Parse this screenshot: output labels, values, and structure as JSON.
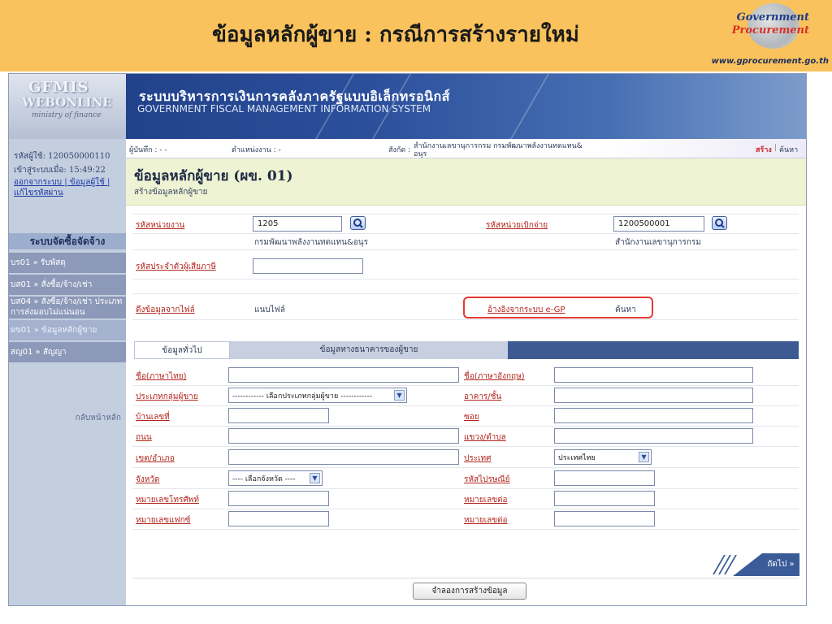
{
  "slide": {
    "title": "ข้อมูลหลักผู้ขาย : กรณีการสร้างรายใหม่",
    "logo_line1": "Government",
    "logo_line2": "Procurement",
    "logo_url": "www.gprocurement.go.th"
  },
  "banner": {
    "gfmis": "GFMIS",
    "webonline": "WEBONLINE",
    "ministry": "ministry of finance",
    "system_thai": "ระบบบริหารการเงินการคลังภาครัฐแบบอิเล็กทรอนิกส์",
    "system_eng": "GOVERNMENT FISCAL MANAGEMENT INFORMATION SYSTEM"
  },
  "sidebar": {
    "user_id": "รหัสผู้ใช้: 120050000110",
    "login_time": "เข้าสู่ระบบเมื่อ: 15:49:22",
    "links_line1": "ออกจากระบบ | ข้อมูลผู้ใช้ |",
    "links_line2": "แก้ไขรหัสผ่าน",
    "menu_header": "ระบบจัดซื้อจัดจ้าง",
    "items": [
      {
        "label": "บร01 » รับพัสดุ"
      },
      {
        "label": "บส01 » สั่งซื้อ/จ้าง/เช่า"
      },
      {
        "label": "บส04 » สั่งซื้อ/จ้าง/เช่า ประเภท"
      },
      {
        "label": "การส่งมอบไม่แน่นอน"
      },
      {
        "label": "ผข01 » ข้อมูลหลักผู้ขาย"
      },
      {
        "label": "สญ01 » สัญญา"
      }
    ],
    "back_label": "กลับหน้าหลัก"
  },
  "infobar": {
    "recorder": "ผู้บันทึก : - -",
    "position": "ตำแหน่งงาน : -",
    "affiliation_label": "สังกัด :",
    "affiliation_line1": "สำนักงานเลขานุการกรม กรมพัฒนาพลังงานทดแทน&",
    "affiliation_line2": "อนุร",
    "create": "สร้าง",
    "search": "ค้นหา"
  },
  "page": {
    "title": "ข้อมูลหลักผู้ขาย (ผข. 01)",
    "subtitle": "สร้างข้อมูลหลักผู้ขาย"
  },
  "header_form": {
    "unit_code_label": "รหัสหน่วยงาน",
    "unit_code_value": "1205",
    "unit_name": "กรมพัฒนาพลังงานทดแทน&อนุร",
    "disburse_code_label": "รหัสหน่วยเบิกจ่าย",
    "disburse_code_value": "1200500001",
    "disburse_name": "สำนักงานเลขานุการกรม",
    "tax_id_label": "รหัสประจำตัวผู้เสียภาษี",
    "tax_id_value": "",
    "file_label": "ดึงข้อมูลจากไฟล์",
    "file_value": "แนบไฟล์",
    "egp_label": "อ้างอิงจากระบบ e-GP",
    "egp_value": "ค้นหา"
  },
  "tabs": [
    {
      "label": "ข้อมูลทั่วไป"
    },
    {
      "label": "ข้อมูลทางธนาคารของผู้ขาย"
    }
  ],
  "general_form": {
    "name_th": "ชื่อ(ภาษาไทย)",
    "name_en": "ชื่อ(ภาษาอังกฤษ)",
    "vendor_group": "ประเภทกลุ่มผู้ขาย",
    "vendor_group_select": "------------ เลือกประเภทกลุ่มผู้ขาย ------------",
    "building": "อาคาร/ชั้น",
    "house_no": "บ้านเลขที่",
    "soi": "ซอย",
    "road": "ถนน",
    "subdistrict": "แขวง/ตำบล",
    "district": "เขต/อำเภอ",
    "country": "ประเทศ",
    "country_select": "ประเทศไทย",
    "province": "จังหวัด",
    "province_select": "---- เลือกจังหวัด ----",
    "postcode": "รหัสไปรษณีย์",
    "phone": "หมายเลขโทรศัพท์",
    "ext1": "หมายเลขต่อ",
    "fax": "หมายเลขแฟกซ์",
    "ext2": "หมายเลขต่อ"
  },
  "buttons": {
    "next": "ถัดไป »",
    "simulate": "จำลองการสร้างข้อมูล"
  },
  "colors": {
    "slide_header": "#f9c25c",
    "banner_blue": "#1d3b82",
    "required_label": "#b3261e",
    "highlight": "#e53935"
  }
}
